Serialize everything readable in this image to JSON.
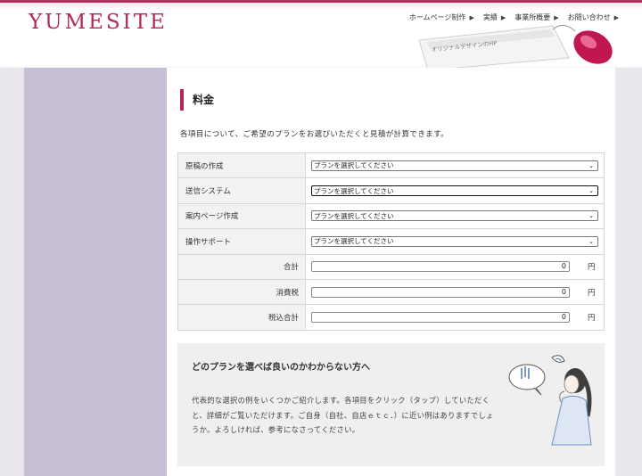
{
  "header": {
    "logo": "YUMESITE",
    "nav": [
      {
        "label": "ホームページ制作"
      },
      {
        "label": "実績"
      },
      {
        "label": "事業所概要"
      },
      {
        "label": "お問い合わせ"
      }
    ],
    "keyboard_caption": "オリジナルデザインのHP"
  },
  "main": {
    "title": "料金",
    "intro": "各項目について、ご希望のプランをお選びいただくと見積が計算できます。",
    "rows": [
      {
        "label": "原稿の作成",
        "select": "プランを選択してください"
      },
      {
        "label": "送信システム",
        "select": "プランを選択してください"
      },
      {
        "label": "案内ページ作成",
        "select": "プランを選択してください"
      },
      {
        "label": "操作サポート",
        "select": "プランを選択してください"
      }
    ],
    "totals": [
      {
        "label": "合計",
        "value": "0",
        "unit": "円"
      },
      {
        "label": "消費税",
        "value": "0",
        "unit": "円"
      },
      {
        "label": "税込合計",
        "value": "0",
        "unit": "円"
      }
    ]
  },
  "help": {
    "title": "どのプランを選べば良いのかわからない方へ",
    "body": "代表的な選択の例をいくつかご紹介します。各項目をクリック（タップ）していただくと、詳細がご覧いただけます。ご自身（自社、自店ｅｔｃ．）に近い例はありますでしょうか。よろしければ、参考になさってください。"
  },
  "colors": {
    "accent": "#b0285a",
    "sidebar": "#c7bfd6",
    "help_bg": "#efefef"
  }
}
